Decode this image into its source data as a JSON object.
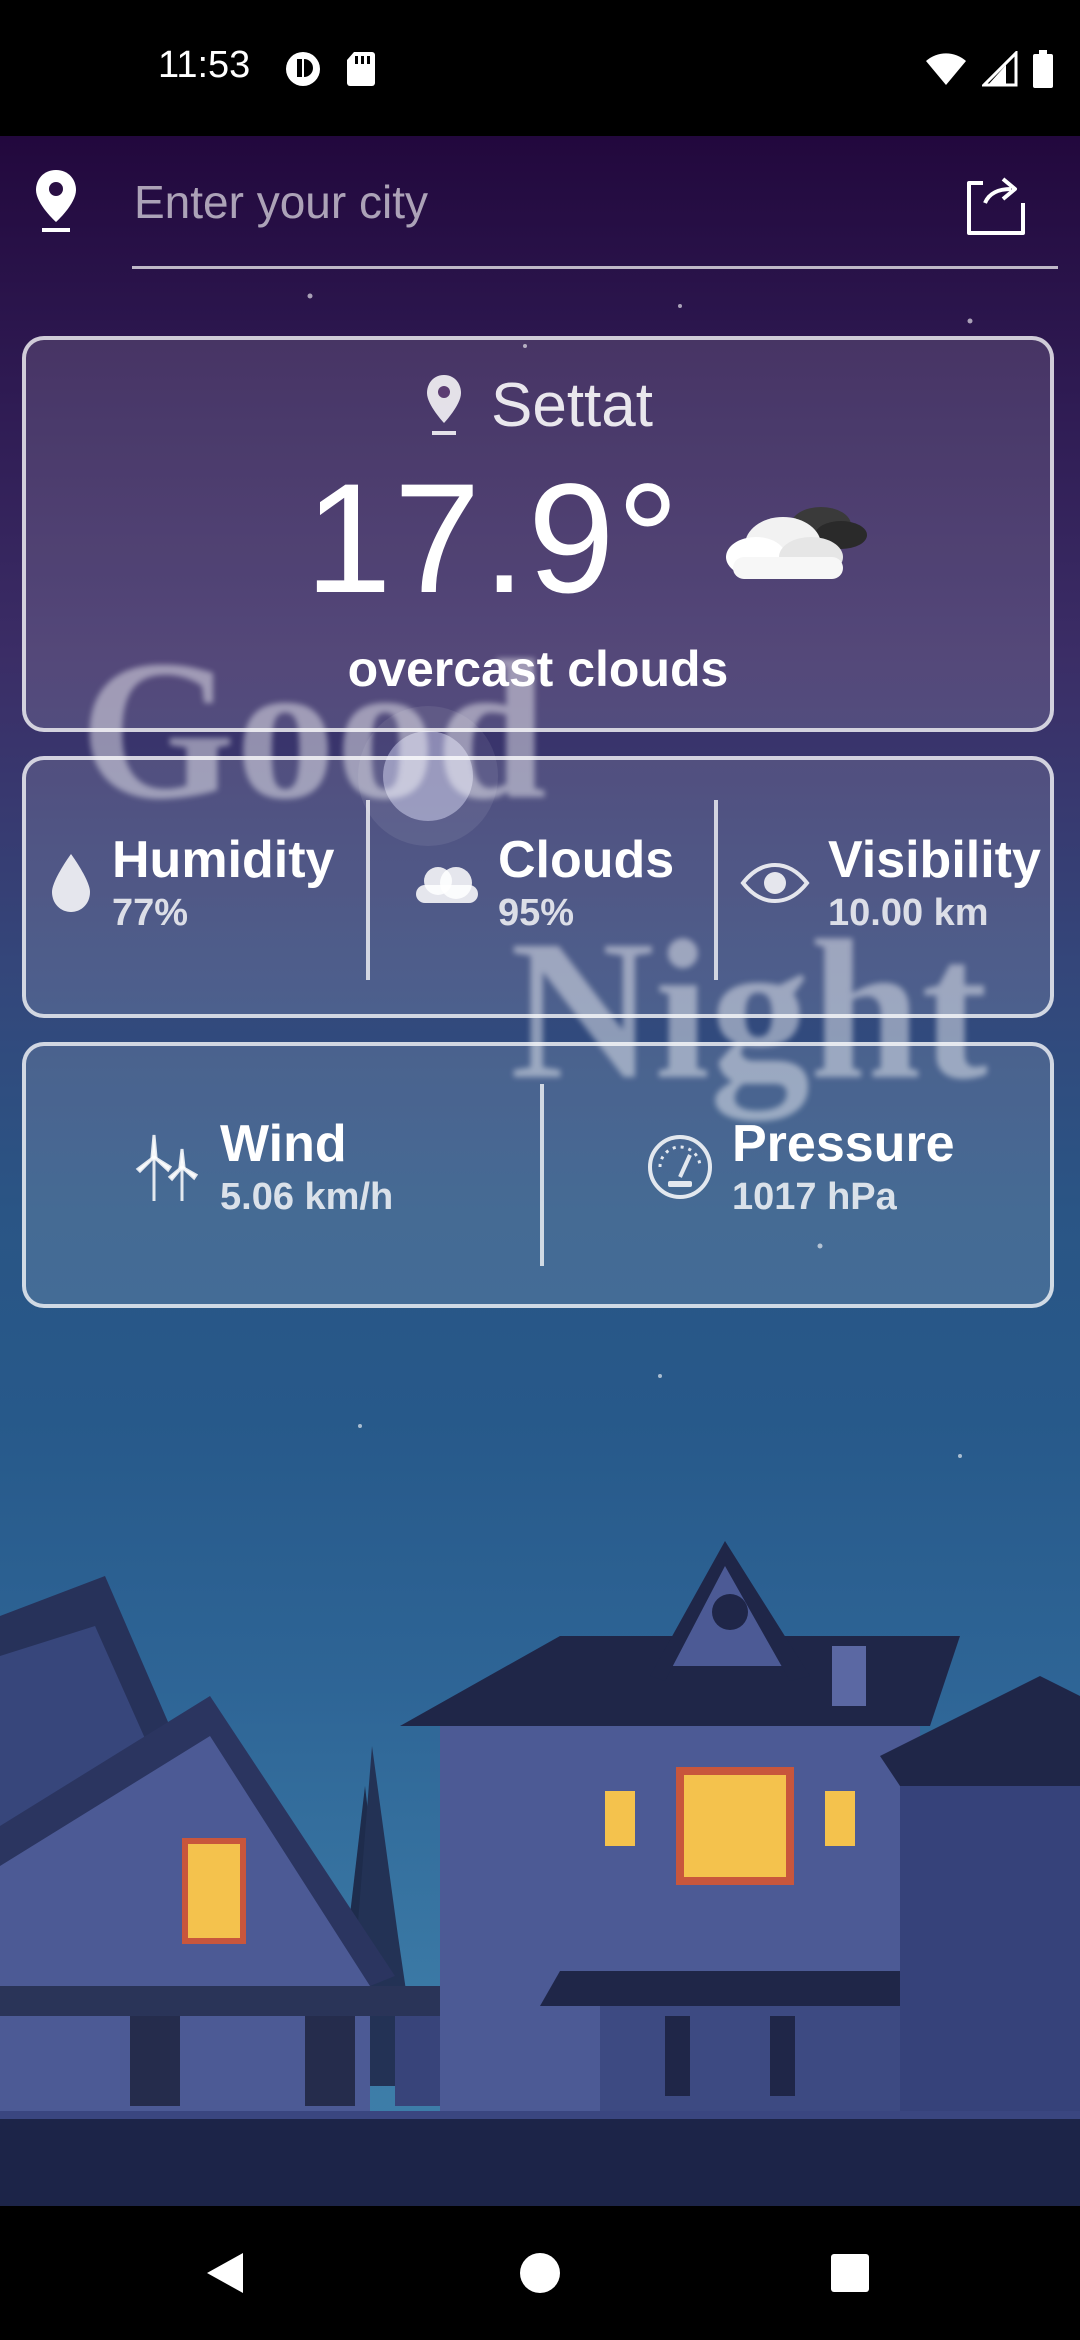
{
  "status_bar": {
    "time": "11:53"
  },
  "search": {
    "placeholder": "Enter your city",
    "value": ""
  },
  "current": {
    "city": "Settat",
    "temperature": "17.9°",
    "description": "overcast clouds",
    "condition_icon": "partly-cloudy-night-icon"
  },
  "stats": {
    "humidity": {
      "label": "Humidity",
      "value": "77%",
      "icon": "water-drop-icon"
    },
    "clouds": {
      "label": "Clouds",
      "value": "95%",
      "icon": "cloud-icon"
    },
    "visibility": {
      "label": "Visibility",
      "value": "10.00 km",
      "icon": "eye-icon"
    },
    "wind": {
      "label": "Wind",
      "value": "5.06 km/h",
      "icon": "wind-turbine-icon"
    },
    "pressure": {
      "label": "Pressure",
      "value": "1017 hPa",
      "icon": "gauge-icon"
    }
  },
  "background": {
    "greeting_line1": "Good",
    "greeting_line2": "Night",
    "accent_window": "#f4c24d",
    "house_color": "#4c5a95"
  }
}
